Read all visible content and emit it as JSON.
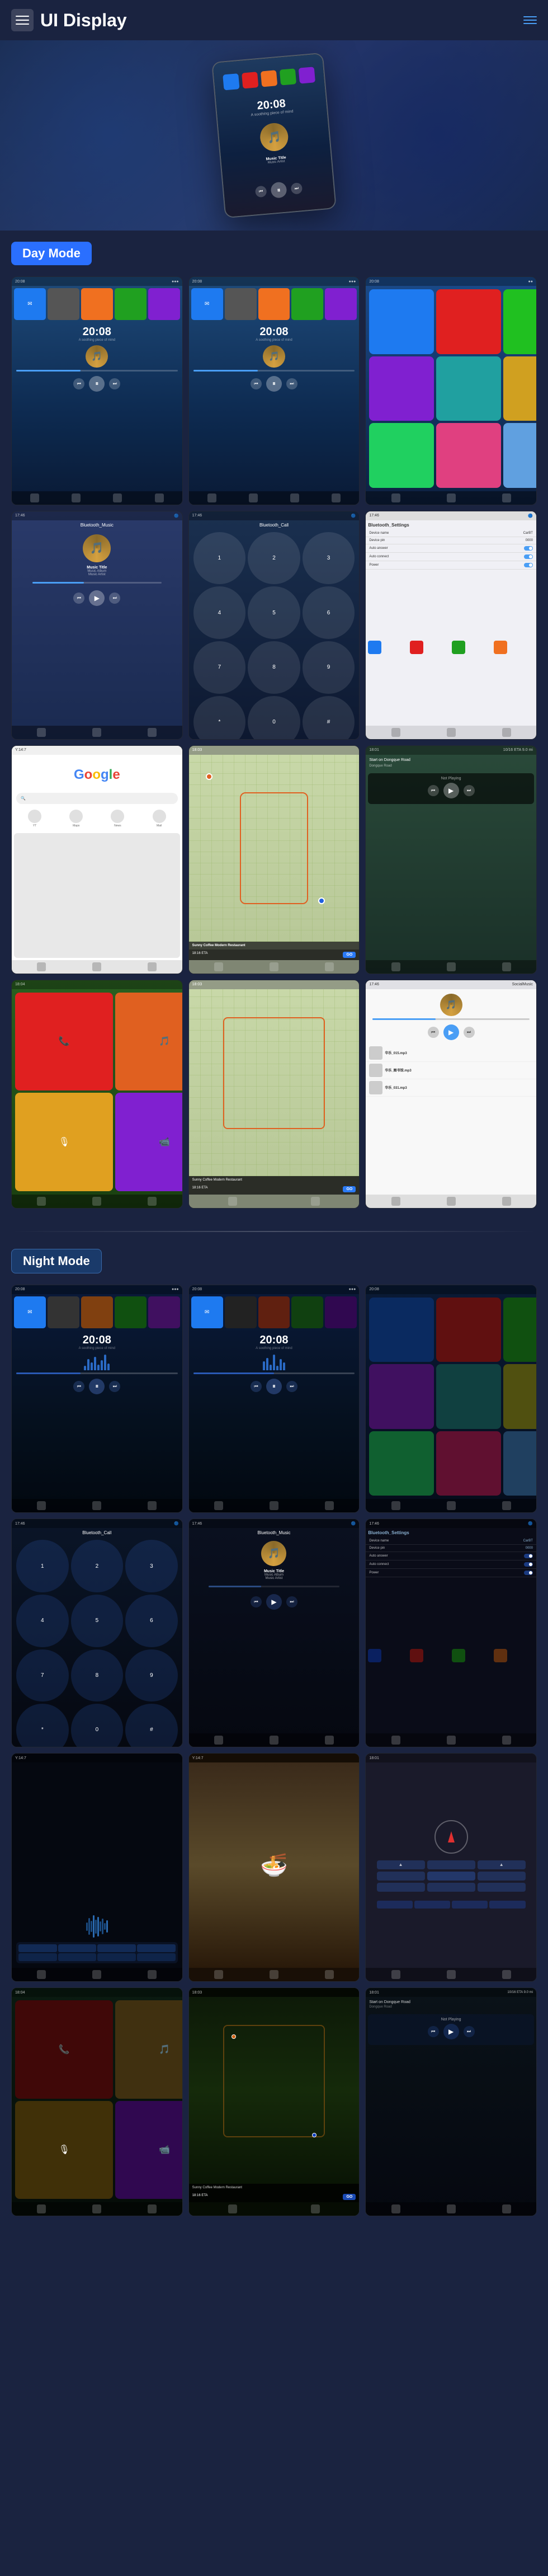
{
  "header": {
    "title": "UI Display",
    "menu_label": "menu",
    "lines_label": "nav-lines"
  },
  "modes": {
    "day_label": "Day Mode",
    "night_label": "Night Mode"
  },
  "music": {
    "title": "Music Title",
    "album": "Music Album",
    "artist": "Music Artist",
    "time": "20:08",
    "subtitle": "A soothing piece of mind"
  },
  "screens": {
    "bluetooth_music": "Bluetooth_Music",
    "bluetooth_call": "Bluetooth_Call",
    "bluetooth_settings": "Bluetooth_Settings",
    "google": "Google",
    "social_music": "SocialMusic",
    "time1": "20:08",
    "time2": "20:08",
    "car_bt": "CarBT",
    "device_pin": "0000"
  },
  "navigation": {
    "restaurant": "Sunny Coffee Modern Restaurant",
    "eta": "18:16 ETA",
    "distance": "9.0 mi",
    "eta2": "18:16 ETA",
    "road": "Start on Dongque Road",
    "go": "GO"
  },
  "keypad": {
    "keys": [
      "1",
      "2",
      "3",
      "4",
      "5",
      "6",
      "7",
      "8",
      "9",
      "*",
      "0",
      "#"
    ]
  },
  "settings": {
    "device_name_label": "Device name",
    "device_name_value": "CarBT",
    "device_pin_label": "Device pin",
    "device_pin_value": "0000",
    "auto_answer_label": "Auto answer",
    "auto_connect_label": "Auto connect",
    "power_label": "Power"
  },
  "songs": [
    {
      "name": "华乐_015.mp3",
      "type": "mp3"
    },
    {
      "name": "华乐_图书馆.mp3",
      "type": "mp3"
    },
    {
      "name": "华乐_031.mp3",
      "type": "mp3"
    }
  ],
  "colors": {
    "accent_blue": "#2a7af5",
    "day_mode_bg": "#2a6fff",
    "night_mode_bg": "#1a3a6a",
    "brand_blue": "#1a2340"
  }
}
